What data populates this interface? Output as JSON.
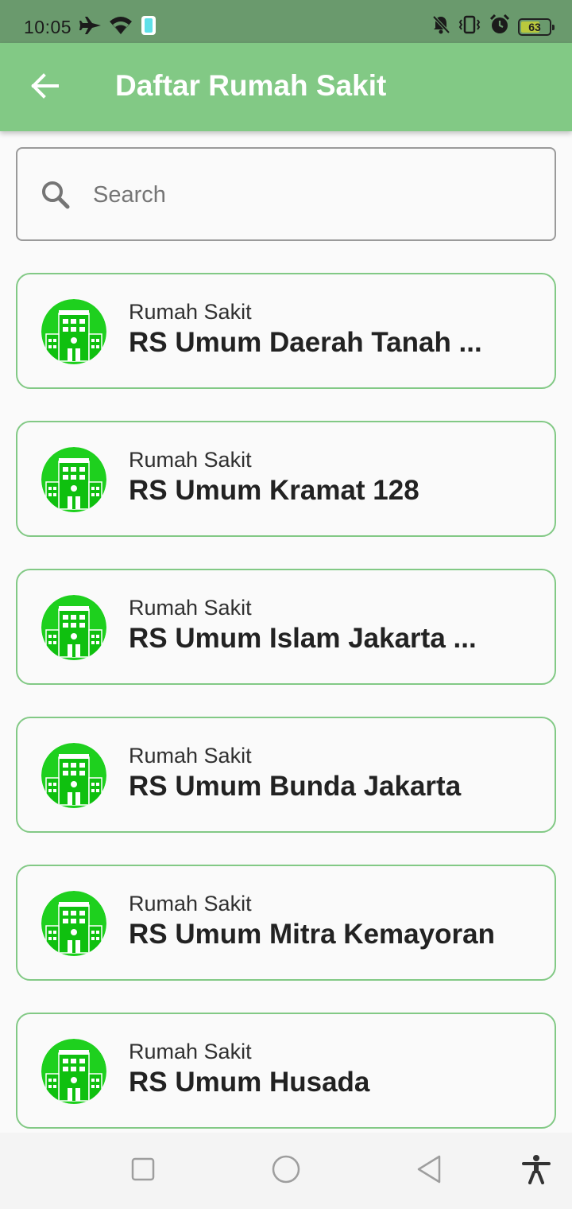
{
  "status_bar": {
    "time": "10:05",
    "battery": "63"
  },
  "app_bar": {
    "title": "Daftar Rumah Sakit"
  },
  "search": {
    "placeholder": "Search",
    "value": ""
  },
  "hospitals": [
    {
      "category": "Rumah Sakit",
      "name": "RS Umum Daerah Tanah ..."
    },
    {
      "category": "Rumah Sakit",
      "name": "RS Umum Kramat 128"
    },
    {
      "category": "Rumah Sakit",
      "name": "RS Umum Islam Jakarta ..."
    },
    {
      "category": "Rumah Sakit",
      "name": "RS Umum Bunda Jakarta"
    },
    {
      "category": "Rumah Sakit",
      "name": "RS Umum Mitra Kemayoran"
    },
    {
      "category": "Rumah Sakit",
      "name": "RS Umum Husada"
    }
  ],
  "icons": {
    "back": "arrow-left-icon",
    "search": "search-icon",
    "hospital": "hospital-building-icon",
    "nav_recents": "square-icon",
    "nav_home": "circle-icon",
    "nav_back": "triangle-back-icon",
    "accessibility": "accessibility-icon"
  },
  "colors": {
    "app_bar": "#82c985",
    "status_bar": "#6a9a6d",
    "card_border": "#82c985",
    "hospital_green": "#19d219"
  }
}
